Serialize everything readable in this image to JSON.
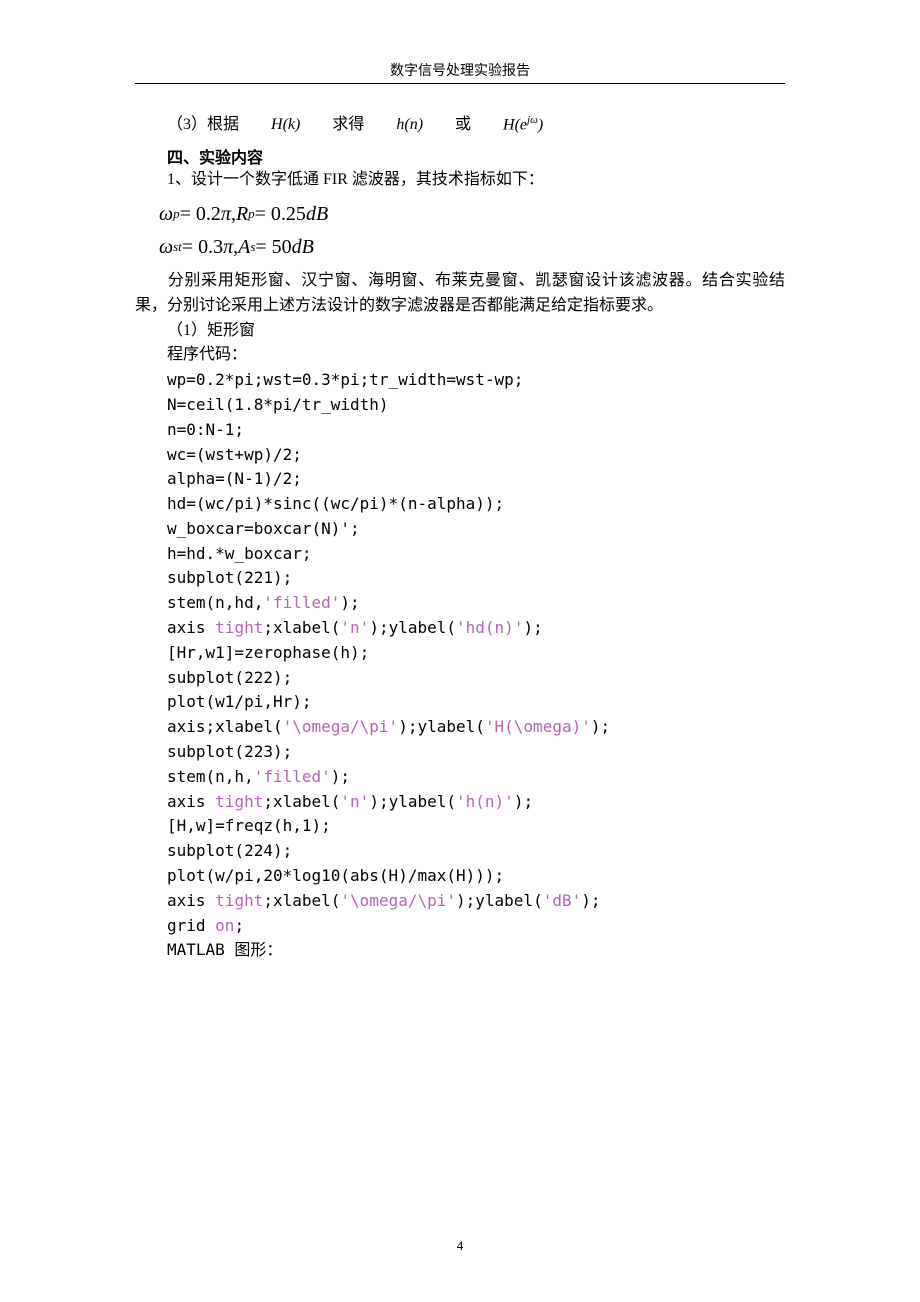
{
  "header": {
    "title": "数字信号处理实验报告"
  },
  "line3": {
    "prefix": "（3）根据",
    "hk": "H",
    "k": "k",
    "mid1": "求得",
    "hn": "h",
    "n": "n",
    "mid2": "或",
    "he": "H",
    "e": "e",
    "jw": "jω",
    "close": ")"
  },
  "section4_title": "四、实验内容",
  "line_design": "1、设计一个数字低通 FIR 滤波器，其技术指标如下：",
  "formula1": {
    "wp": "ω",
    "p_sub": "p",
    "eq1": " = 0.2",
    "pi1": "π",
    "comma": ", ",
    "rp": "R",
    "eq2": " = 0.25",
    "db": "dB"
  },
  "formula2": {
    "wst": "ω",
    "st_sub": "st",
    "eq1": " = 0.3",
    "pi1": "π",
    "comma": ", ",
    "as": "A",
    "s_sub": "s",
    "eq2": " = 50",
    "db": "dB"
  },
  "para1": "分别采用矩形窗、汉宁窗、海明窗、布莱克曼窗、凯瑟窗设计该滤波器。结合实验结果，分别讨论采用上述方法设计的数字滤波器是否都能满足给定指标要求。",
  "label_rect": "（1）矩形窗",
  "label_code": "程序代码：",
  "code": {
    "l1": "wp=0.2*pi;wst=0.3*pi;tr_width=wst-wp;",
    "l2": "N=ceil(1.8*pi/tr_width)",
    "l3": "n=0:N-1;",
    "l4": "wc=(wst+wp)/2;",
    "l5": "alpha=(N-1)/2;",
    "l6": "hd=(wc/pi)*sinc((wc/pi)*(n-alpha));",
    "l7": "w_boxcar=boxcar(N)';",
    "l8": "h=hd.*w_boxcar;",
    "l9": "subplot(221);",
    "l10_a": "stem(n,hd,",
    "l10_b": "'filled'",
    "l10_c": ");",
    "l11_a": "axis ",
    "l11_b": "tight",
    "l11_c": ";xlabel(",
    "l11_d": "'n'",
    "l11_e": ");ylabel(",
    "l11_f": "'hd(n)'",
    "l11_g": ");",
    "l12": "[Hr,w1]=zerophase(h);",
    "l13": "subplot(222);",
    "l14": "plot(w1/pi,Hr);",
    "l15_a": "axis;xlabel(",
    "l15_b": "'\\omega/\\pi'",
    "l15_c": ");ylabel(",
    "l15_d": "'H(\\omega)'",
    "l15_e": ");",
    "l16": "subplot(223);",
    "l17_a": "stem(n,h,",
    "l17_b": "'filled'",
    "l17_c": ");",
    "l18_a": "axis ",
    "l18_b": "tight",
    "l18_c": ";xlabel(",
    "l18_d": "'n'",
    "l18_e": ");ylabel(",
    "l18_f": "'h(n)'",
    "l18_g": ");",
    "l19": "[H,w]=freqz(h,1);",
    "l20": "subplot(224);",
    "l21": "plot(w/pi,20*log10(abs(H)/max(H)));",
    "l22_a": "axis ",
    "l22_b": "tight",
    "l22_c": ";xlabel(",
    "l22_d": "'\\omega/\\pi'",
    "l22_e": ");ylabel(",
    "l22_f": "'dB'",
    "l22_g": ");",
    "l23_a": "grid ",
    "l23_b": "on",
    "l23_c": ";",
    "l24": "MATLAB 图形："
  },
  "page_number": "4"
}
